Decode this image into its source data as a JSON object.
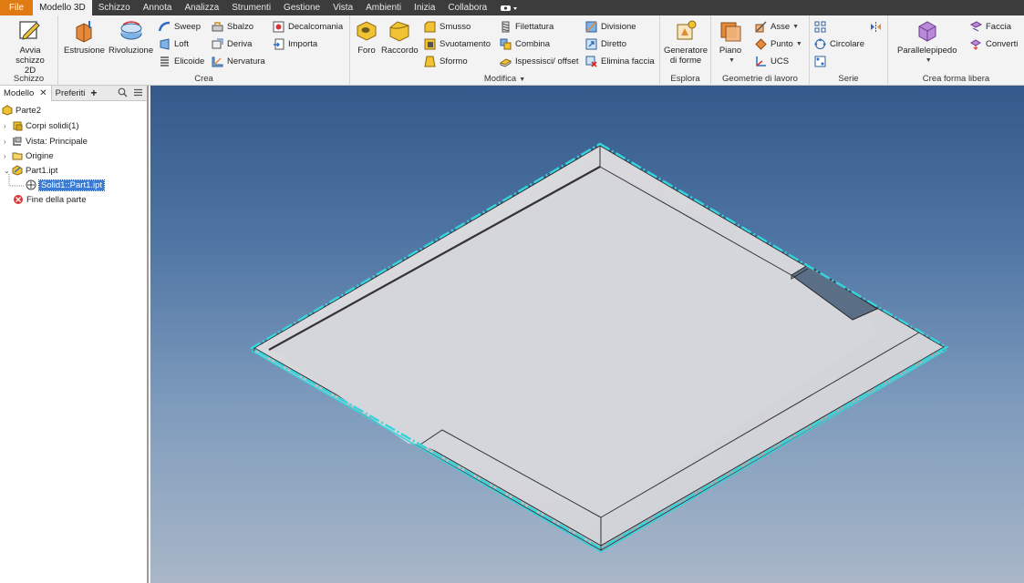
{
  "menu": {
    "tabs": [
      "File",
      "Modello 3D",
      "Schizzo",
      "Annota",
      "Analizza",
      "Strumenti",
      "Gestione",
      "Vista",
      "Ambienti",
      "Inizia",
      "Collabora"
    ],
    "extra_icon": "camera-dropdown-icon"
  },
  "ribbon": {
    "schizzo": {
      "title": "Schizzo",
      "start_sketch": "Avvia schizzo 2D"
    },
    "crea": {
      "title": "Crea",
      "estrusione": "Estrusione",
      "rivoluzione": "Rivoluzione",
      "sweep": "Sweep",
      "loft": "Loft",
      "elicoide": "Elicoide",
      "sbalzo": "Sbalzo",
      "deriva": "Deriva",
      "nervatura": "Nervatura",
      "decalcomania": "Decalcomania",
      "importa": "Importa"
    },
    "modifica": {
      "title": "Modifica",
      "foro": "Foro",
      "raccordo": "Raccordo",
      "smusso": "Smusso",
      "svuotamento": "Svuotamento",
      "sformo": "Sformo",
      "filettatura": "Filettatura",
      "combina": "Combina",
      "ispessisci": "Ispessisci/ offset",
      "divisione": "Divisione",
      "diretto": "Diretto",
      "elimina_faccia": "Elimina faccia"
    },
    "esplora": {
      "title": "Esplora",
      "generatore_line1": "Generatore",
      "generatore_line2": "di forme"
    },
    "geometrie": {
      "title": "Geometrie di lavoro",
      "piano": "Piano",
      "asse": "Asse",
      "punto": "Punto",
      "ucs": "UCS"
    },
    "serie": {
      "title": "Serie",
      "circolare": "Circolare"
    },
    "forma_libera": {
      "title": "Crea forma libera",
      "parallelepipedo": "Parallelepipedo",
      "faccia": "Faccia",
      "converti": "Converti"
    }
  },
  "browser": {
    "tab_model": "Modello",
    "tab_favorites": "Preferiti",
    "tree": [
      {
        "label": "Parte2"
      },
      {
        "label": "Corpi solidi(1)"
      },
      {
        "label": "Vista: Principale"
      },
      {
        "label": "Origine"
      },
      {
        "label": "Part1.ipt"
      },
      {
        "label": "Solid1::Part1.ipt"
      },
      {
        "label": "Fine della parte"
      }
    ]
  },
  "colors": {
    "file_tab": "#e07a12",
    "selection": "#3a7bd5",
    "highlight_edge": "#35d4dc",
    "part_face": "#d8d8dc"
  }
}
